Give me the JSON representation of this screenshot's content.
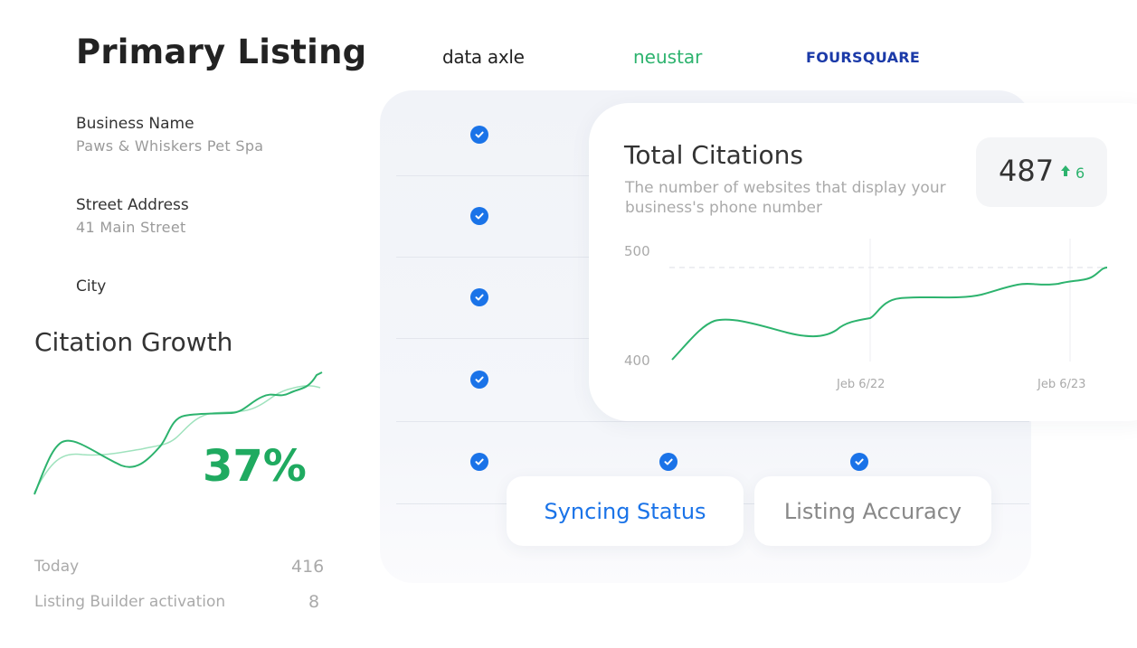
{
  "primary_listing": {
    "title": "Primary Listing",
    "fields": [
      {
        "label": "Business Name",
        "value": "Paws & Whiskers Pet Spa"
      },
      {
        "label": "Street Address",
        "value": "41 Main Street"
      },
      {
        "label": "City",
        "value": ""
      }
    ]
  },
  "brands": {
    "data_axle": "data axle",
    "neustar": "neustar",
    "foursquare": "FOURSQUARE"
  },
  "total_citations": {
    "title": "Total Citations",
    "description": "The number of websites that display your business's phone number",
    "value": "487",
    "delta": "6",
    "delta_icon": "arrow-up-icon",
    "chart_data": {
      "type": "line",
      "y_ticks": [
        "500",
        "400"
      ],
      "x_ticks": [
        "Jeb 6/22",
        "Jeb 6/23"
      ],
      "ylim": [
        400,
        500
      ],
      "series_color": "#2db36e"
    }
  },
  "citation_growth": {
    "title": "Citation Growth",
    "percent": "37%",
    "stats": [
      {
        "label": "Today",
        "value": "416"
      },
      {
        "label": "Listing Builder activation",
        "value": "8"
      }
    ]
  },
  "pills": {
    "syncing_status": "Syncing Status",
    "listing_accuracy": "Listing Accuracy"
  },
  "colors": {
    "accent_blue": "#1a73e8",
    "accent_green": "#2db36e",
    "foursquare_blue": "#1b3aa8"
  }
}
